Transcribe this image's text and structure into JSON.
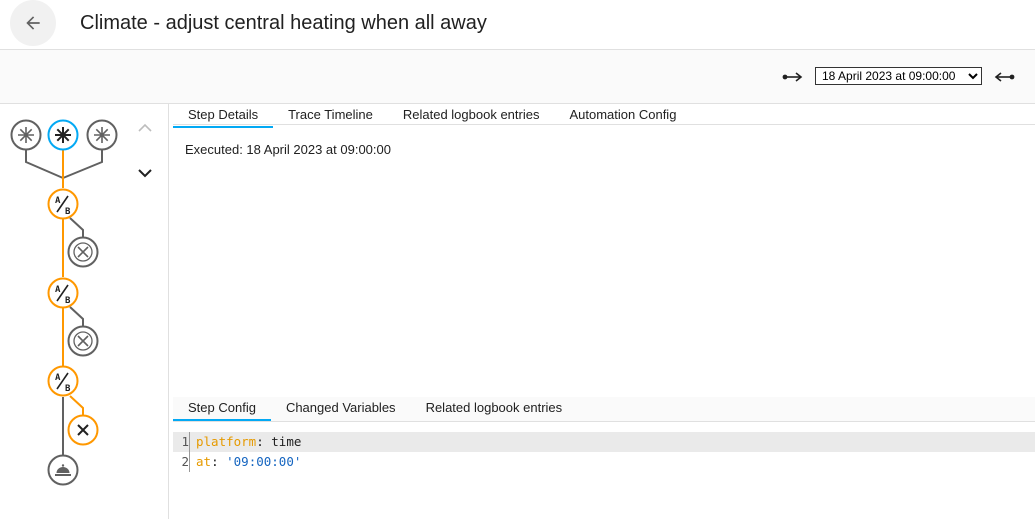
{
  "header": {
    "title": "Climate - adjust central heating when all away"
  },
  "toolbar": {
    "selected_trace": "18 April 2023 at 09:00:00",
    "trace_options": [
      "18 April 2023 at 09:00:00"
    ]
  },
  "top_tabs": [
    "Step Details",
    "Trace Timeline",
    "Related logbook entries",
    "Automation Config"
  ],
  "step_details": {
    "executed": "Executed: 18 April 2023 at 09:00:00"
  },
  "bottom_tabs": [
    "Step Config",
    "Changed Variables",
    "Related logbook entries"
  ],
  "code": {
    "lines": [
      {
        "num": "1",
        "key": "platform",
        "sep": ": ",
        "value": "time",
        "value_type": "plain"
      },
      {
        "num": "2",
        "key": "at",
        "sep": ": ",
        "value": "'09:00:00'",
        "value_type": "string"
      }
    ]
  },
  "colors": {
    "accent": "#03a9f4",
    "trace_active": "#ff9800",
    "inactive": "#616161"
  },
  "graph": {
    "icons": [
      "trigger-icon",
      "trigger-icon-active",
      "trigger-icon",
      "condition-icon",
      "stop-icon",
      "condition-icon",
      "stop-icon",
      "condition-icon",
      "stop-icon-active",
      "finish-icon"
    ]
  }
}
